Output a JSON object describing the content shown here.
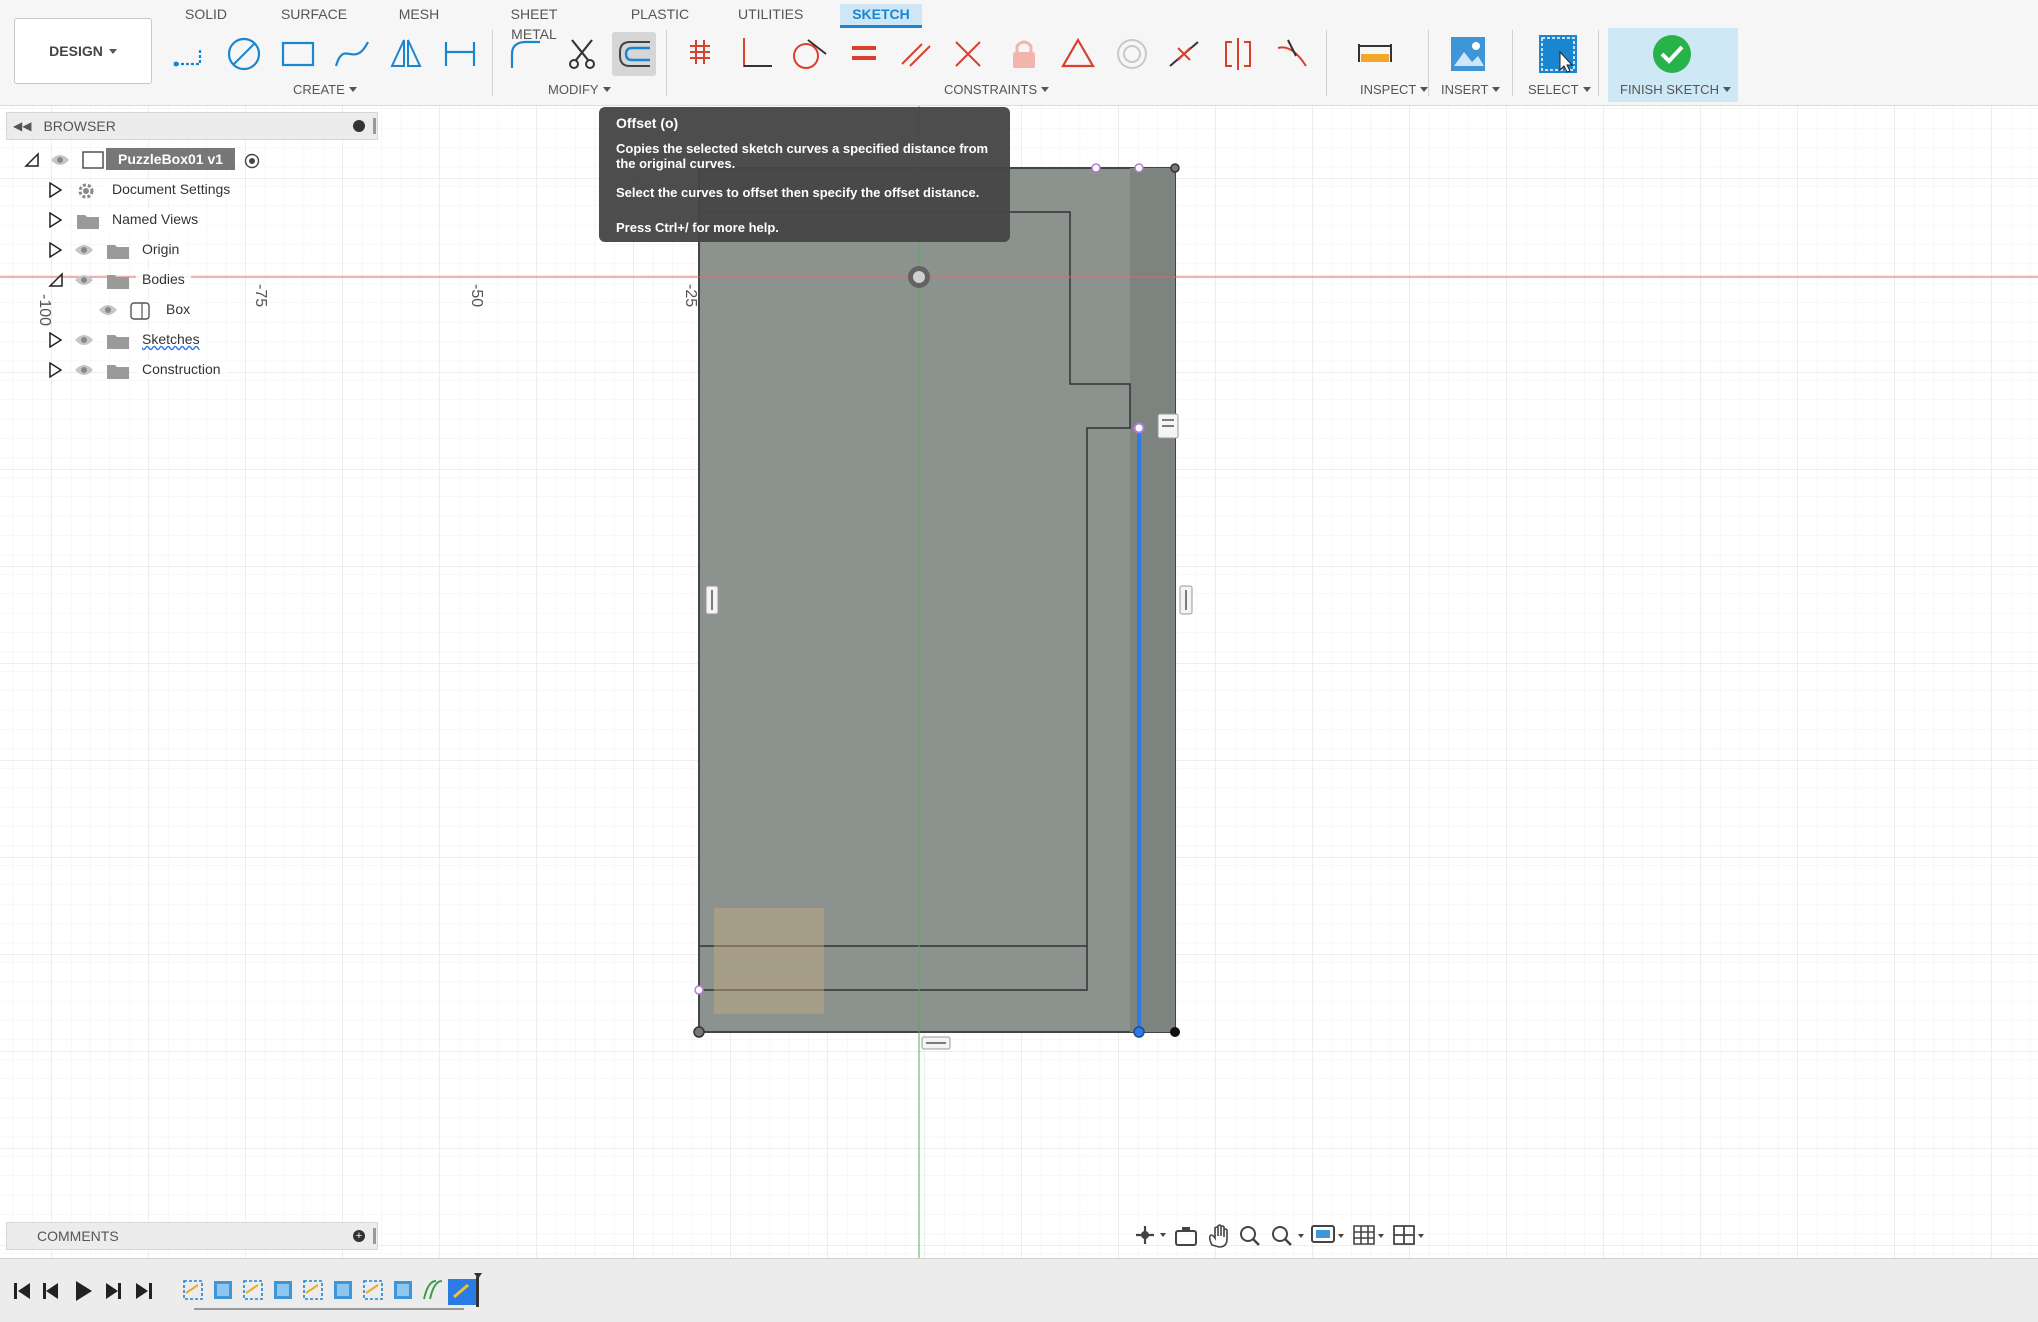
{
  "design_button": {
    "label": "DESIGN"
  },
  "tabs": [
    {
      "label": "SOLID"
    },
    {
      "label": "SURFACE"
    },
    {
      "label": "MESH"
    },
    {
      "label": "SHEET METAL"
    },
    {
      "label": "PLASTIC"
    },
    {
      "label": "UTILITIES"
    },
    {
      "label": "SKETCH",
      "active": true
    }
  ],
  "groups": {
    "create": "CREATE",
    "modify": "MODIFY",
    "constraints": "CONSTRAINTS",
    "inspect": "INSPECT",
    "insert": "INSERT",
    "select": "SELECT",
    "finish": "FINISH SKETCH"
  },
  "tools": {
    "create": [
      "line-icon",
      "circle-icon",
      "rectangle-icon",
      "spline-icon",
      "mirror-icon",
      "dimension-icon"
    ],
    "modify": [
      "fillet-icon",
      "trim-icon",
      "offset-icon"
    ],
    "constraints": [
      "coincident-icon",
      "perpendicular-icon",
      "tangent-icon",
      "equal-icon",
      "parallel-icon",
      "collinear-icon",
      "fix-icon",
      "triangle-icon",
      "concentric-icon",
      "midpoint-icon",
      "symmetry-icon",
      "curvature-icon"
    ]
  },
  "browser": {
    "title": "BROWSER",
    "root": "PuzzleBox01 v1",
    "items": [
      {
        "label": "Document Settings"
      },
      {
        "label": "Named Views"
      },
      {
        "label": "Origin"
      },
      {
        "label": "Bodies"
      },
      {
        "label": "Box"
      },
      {
        "label": "Sketches"
      },
      {
        "label": "Construction"
      }
    ]
  },
  "tooltip": {
    "title": "Offset (o)",
    "description": "Copies the selected sketch curves a specified distance from the original curves.",
    "instruction": "Select the curves to offset then specify the offset distance.",
    "help": "Press Ctrl+/ for more help."
  },
  "axis_ticks": [
    "-100",
    "-75",
    "-50",
    "-25"
  ],
  "comments": {
    "title": "COMMENTS"
  },
  "colors": {
    "sketch_fill": "#8c938e",
    "selected_line": "#2a7be4",
    "x_axis": "#e0685e",
    "y_axis": "#4cb05a",
    "accent": "#1a86d0",
    "finish_check": "#27b34a"
  }
}
